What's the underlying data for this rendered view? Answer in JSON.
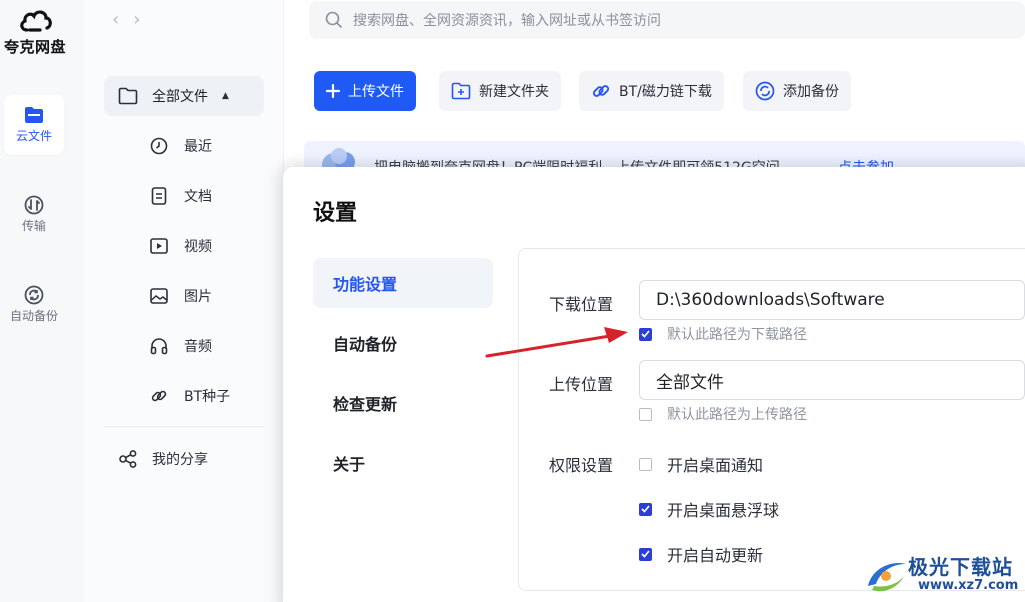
{
  "app": {
    "name": "夸克网盘"
  },
  "rail": {
    "items": [
      {
        "label": "云文件",
        "icon": "folder-icon",
        "active": true
      },
      {
        "label": "传输",
        "icon": "transfer-icon",
        "active": false
      },
      {
        "label": "自动备份",
        "icon": "sync-icon",
        "active": false
      }
    ]
  },
  "categories": {
    "all": "全部文件",
    "items": [
      {
        "label": "最近",
        "icon": "clock-icon"
      },
      {
        "label": "文档",
        "icon": "document-icon"
      },
      {
        "label": "视频",
        "icon": "video-icon"
      },
      {
        "label": "图片",
        "icon": "image-icon"
      },
      {
        "label": "音频",
        "icon": "headphones-icon"
      },
      {
        "label": "BT种子",
        "icon": "link-icon"
      }
    ],
    "share": "我的分享"
  },
  "search": {
    "placeholder": "搜索网盘、全网资源资讯，输入网址或从书签访问"
  },
  "toolbar": {
    "upload": "上传文件",
    "new_folder": "新建文件夹",
    "bt_download": "BT/磁力链下载",
    "add_backup": "添加备份"
  },
  "banner": {
    "text": "把电脑搬到夸克网盘！PC端限时福利，上传文件即可领512G空间",
    "link": "点击参加"
  },
  "settings": {
    "title": "设置",
    "tabs": [
      "功能设置",
      "自动备份",
      "检查更新",
      "关于"
    ],
    "active_tab": "功能设置",
    "download_label": "下载位置",
    "download_path": "D:\\360downloads\\Software",
    "download_default": "默认此路径为下载路径",
    "download_default_checked": true,
    "upload_label": "上传位置",
    "upload_path": "全部文件",
    "upload_default": "默认此路径为上传路径",
    "upload_default_checked": false,
    "permission_label": "权限设置",
    "permissions": [
      {
        "label": "开启桌面通知",
        "checked": false
      },
      {
        "label": "开启桌面悬浮球",
        "checked": true
      },
      {
        "label": "开启自动更新",
        "checked": true
      }
    ]
  },
  "colors": {
    "accent": "#2456f2",
    "primary_button": "#1f5af5",
    "arrow": "#d6232a",
    "checkbox": "#2b3fd6"
  },
  "watermark": {
    "text": "极光下载站",
    "url": "www.xz7.com"
  }
}
